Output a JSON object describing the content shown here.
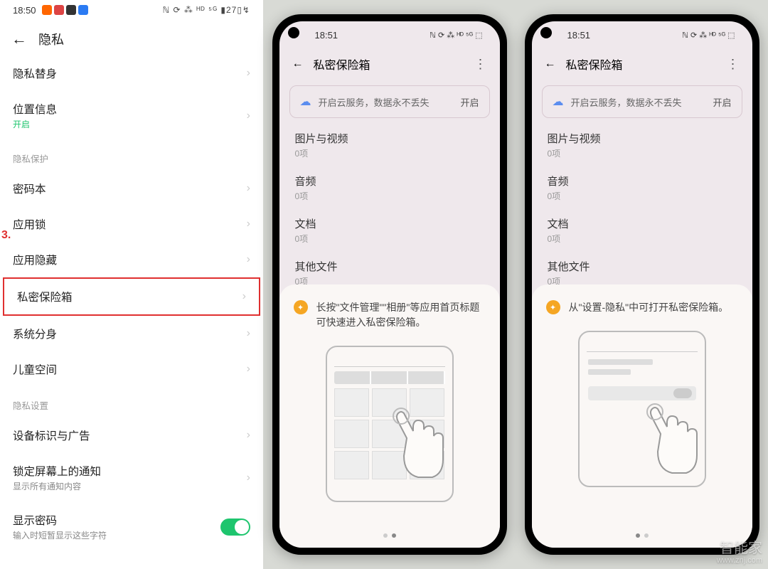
{
  "col1": {
    "status": {
      "time": "18:50",
      "battery": "27"
    },
    "title": "隐私",
    "step_marker": "3.",
    "rows": [
      {
        "label": "隐私替身",
        "sub": "",
        "chev": true
      },
      {
        "label": "位置信息",
        "sub": "开启",
        "sub_green": true,
        "chev": true
      }
    ],
    "section1": "隐私保护",
    "rows2": [
      {
        "label": "密码本",
        "chev": true
      },
      {
        "label": "应用锁",
        "chev": true
      },
      {
        "label": "应用隐藏",
        "chev": true
      },
      {
        "label": "私密保险箱",
        "chev": true,
        "highlight": true
      },
      {
        "label": "系统分身",
        "chev": true
      },
      {
        "label": "儿童空间",
        "chev": true
      }
    ],
    "section2": "隐私设置",
    "rows3": [
      {
        "label": "设备标识与广告",
        "chev": true
      },
      {
        "label": "锁定屏幕上的通知",
        "sub": "显示所有通知内容",
        "chev": true
      },
      {
        "label": "显示密码",
        "sub": "输入时短暂显示这些字符",
        "toggle": true
      }
    ]
  },
  "phone_a": {
    "status_time": "18:51",
    "title": "私密保险箱",
    "cloud_text": "开启云服务，数据永不丢失",
    "cloud_action": "开启",
    "cats": [
      {
        "label": "图片与视频",
        "count": "0项"
      },
      {
        "label": "音频",
        "count": "0项"
      },
      {
        "label": "文档",
        "count": "0项"
      },
      {
        "label": "其他文件",
        "count": "0项"
      }
    ],
    "tip": "长按\"文件管理\"\"相册\"等应用首页标题可快速进入私密保险箱。"
  },
  "phone_b": {
    "status_time": "18:51",
    "title": "私密保险箱",
    "cloud_text": "开启云服务，数据永不丢失",
    "cloud_action": "开启",
    "cats": [
      {
        "label": "图片与视频",
        "count": "0项"
      },
      {
        "label": "音频",
        "count": "0项"
      },
      {
        "label": "文档",
        "count": "0项"
      },
      {
        "label": "其他文件",
        "count": "0项"
      }
    ],
    "tip": "从\"设置-隐私\"中可打开私密保险箱。"
  },
  "watermark": {
    "main": "智能家",
    "sub": "www.znj.com"
  }
}
